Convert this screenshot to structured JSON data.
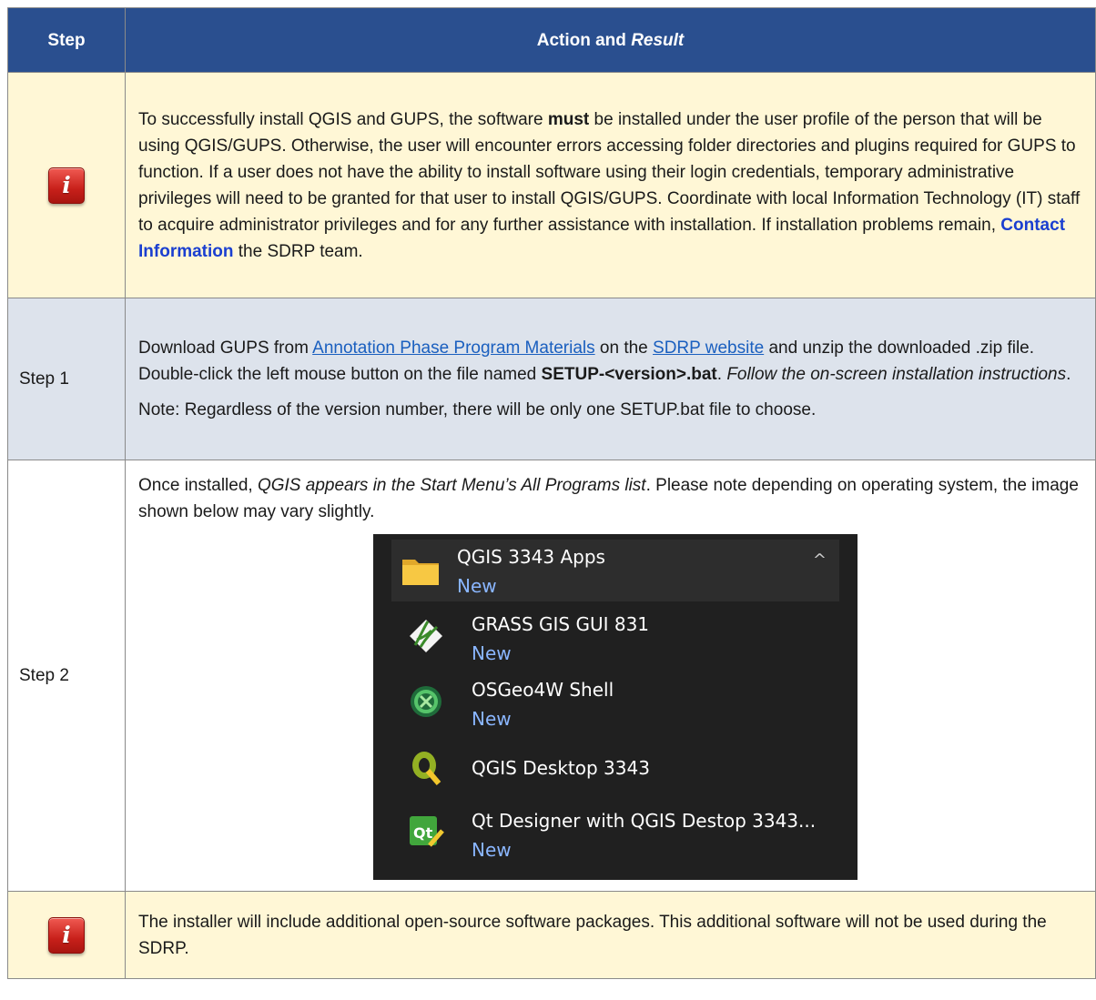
{
  "header": {
    "step": "Step",
    "action_prefix": "Action and ",
    "action_italic": "Result"
  },
  "note1": {
    "t1": "To successfully install QGIS and GUPS, the software ",
    "bold": "must",
    "t2": " be installed under the user profile of the person that will be using QGIS/GUPS. Otherwise, the user will encounter errors accessing folder directories and plugins required for GUPS to function. If a user does not have the ability to install software using their login credentials, temporary administrative privileges will need to be granted for that user to install QGIS/GUPS. Coordinate with local Information Technology (IT) staff to acquire administrator privileges and for any further assistance with installation. If installation problems remain, ",
    "link": "Contact Information",
    "t3": " the SDRP team."
  },
  "step1": {
    "label": "Step 1",
    "t1": "Download GUPS from ",
    "link1": "Annotation Phase Program Materials",
    "t2": " on the ",
    "link2": "SDRP website",
    "t3": " and unzip the downloaded .zip file. Double-click the left mouse button on the file named ",
    "bold": "SETUP-<version>.bat",
    "t4": ". ",
    "italic": "Follow the on-screen installation instructions",
    "t5": ".",
    "note": "Note: Regardless of the version number, there will be only one SETUP.bat file to choose."
  },
  "step2": {
    "label": "Step 2",
    "t1": "Once installed, ",
    "italic": "QGIS appears in the Start Menu’s All Programs list",
    "t2": ". Please note depending on operating system, the image shown below may vary slightly.",
    "menu": {
      "folder": {
        "name": "QGIS 3343 Apps",
        "badge": "New",
        "icon": "folder-icon",
        "chevron": "chevron-up-icon"
      },
      "items": [
        {
          "name": "GRASS GIS GUI 831",
          "badge": "New",
          "icon": "grass-icon"
        },
        {
          "name": "OSGeo4W Shell",
          "badge": "New",
          "icon": "osgeo-icon"
        },
        {
          "name": "QGIS Desktop 3343",
          "badge": "",
          "icon": "qgis-icon"
        },
        {
          "name": "Qt Designer with QGIS Destop 3343...",
          "badge": "New",
          "icon": "qt-icon"
        }
      ]
    }
  },
  "note2": {
    "text": "The installer will include additional open-source software packages. This additional software will not be used during the SDRP."
  },
  "colors": {
    "header_bg": "#2a4f8f",
    "note_bg": "#fff7d6",
    "step1_bg": "#dde3ec",
    "menu_bg": "#202020",
    "new_badge": "#8ab6ff"
  }
}
